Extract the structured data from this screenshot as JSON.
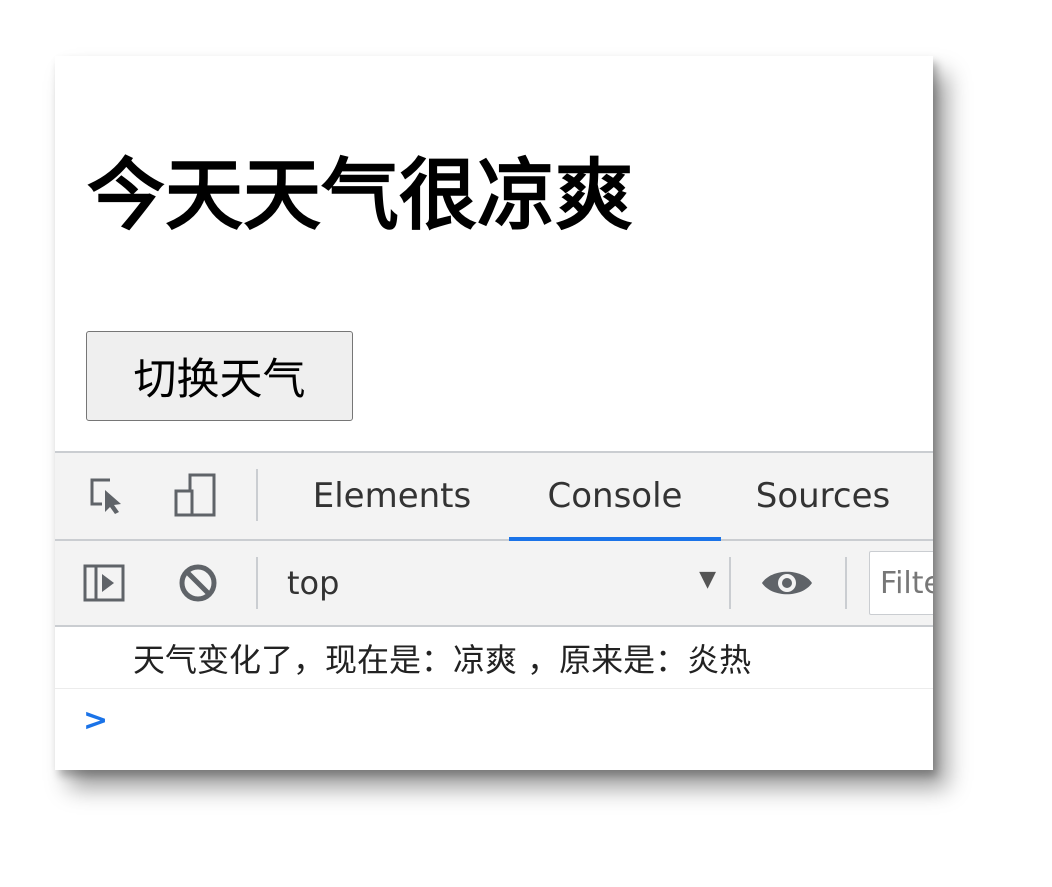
{
  "page": {
    "heading": "今天天气很凉爽",
    "toggle_button_label": "切换天气"
  },
  "devtools": {
    "tabs": [
      {
        "label": "Elements",
        "active": false
      },
      {
        "label": "Console",
        "active": true
      },
      {
        "label": "Sources",
        "active": false
      }
    ],
    "toolbar": {
      "context": "top",
      "filter_placeholder": "Filter"
    },
    "console": {
      "messages": [
        "天气变化了，现在是：凉爽 ，原来是：炎热"
      ],
      "prompt_symbol": ">"
    },
    "icons": {
      "inspect": "inspect-element-icon",
      "device": "device-toolbar-icon",
      "sidebar": "console-sidebar-icon",
      "clear": "clear-console-icon",
      "eye": "live-expression-eye-icon",
      "dropdown": "dropdown-arrow-icon",
      "prompt": "console-prompt-chevron-icon"
    },
    "colors": {
      "accent": "#1a73e8",
      "toolbar_bg": "#f3f3f3",
      "separator": "#cacdd1"
    }
  }
}
